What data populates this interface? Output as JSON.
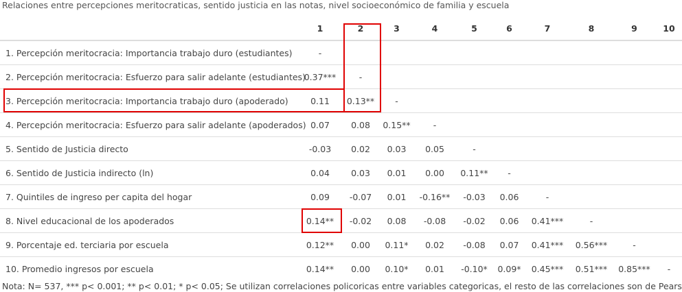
{
  "caption": "Relaciones entre percepciones meritocraticas, sentido justicia en las notas, nivel socioeconómico de familia y escuela",
  "table": {
    "header": [
      "",
      "1",
      "2",
      "3",
      "4",
      "5",
      "6",
      "7",
      "8",
      "9",
      "10"
    ],
    "rows": [
      [
        "1. Percepción meritocracia: Importancia trabajo duro (estudiantes)",
        "-",
        "",
        "",
        "",
        "",
        "",
        "",
        "",
        "",
        ""
      ],
      [
        "2. Percepción meritocracia: Esfuerzo para salir adelante (estudiantes)",
        "0.37***",
        "-",
        "",
        "",
        "",
        "",
        "",
        "",
        "",
        ""
      ],
      [
        "3. Percepción meritocracia: Importancia trabajo duro (apoderado)",
        "0.11",
        "0.13**",
        "-",
        "",
        "",
        "",
        "",
        "",
        "",
        ""
      ],
      [
        "4. Percepción meritocracia: Esfuerzo para salir adelante (apoderados)",
        "0.07",
        "0.08",
        "0.15**",
        "-",
        "",
        "",
        "",
        "",
        "",
        ""
      ],
      [
        "5. Sentido de Justicia directo",
        "-0.03",
        "0.02",
        "0.03",
        "0.05",
        "-",
        "",
        "",
        "",
        "",
        ""
      ],
      [
        "6. Sentido de Justicia indirecto (ln)",
        "0.04",
        "0.03",
        "0.01",
        "0.00",
        "0.11**",
        "-",
        "",
        "",
        "",
        ""
      ],
      [
        "7. Quintiles de ingreso per capita del hogar",
        "0.09",
        "-0.07",
        "0.01",
        "-0.16**",
        "-0.03",
        "0.06",
        "-",
        "",
        "",
        ""
      ],
      [
        "8. Nivel educacional de los apoderados",
        "0.14**",
        "-0.02",
        "0.08",
        "-0.08",
        "-0.02",
        "0.06",
        "0.41***",
        "-",
        "",
        ""
      ],
      [
        "9. Porcentaje ed. terciaria por escuela",
        "0.12**",
        "0.00",
        "0.11*",
        "0.02",
        "-0.08",
        "0.07",
        "0.41***",
        "0.56***",
        "-",
        ""
      ],
      [
        "10. Promedio ingresos por escuela",
        "0.14**",
        "0.00",
        "0.10*",
        "0.01",
        "-0.10*",
        "0.09*",
        "0.45***",
        "0.51***",
        "0.85***",
        "-"
      ]
    ]
  },
  "note": "Nota: N= 537, *** p< 0.001; ** p< 0.01; * p< 0.05; Se utilizan correlaciones policoricas entre variables categoricas, el resto de las correlaciones son de Pearson",
  "highlight_color": "#e00000"
}
